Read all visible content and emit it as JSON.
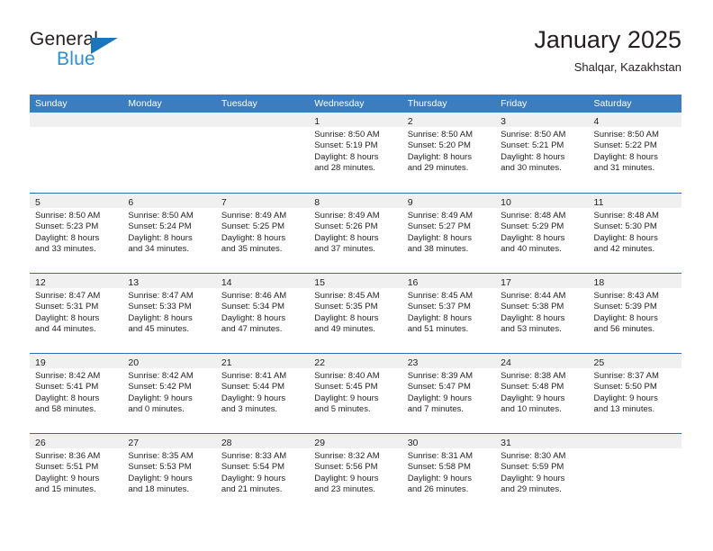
{
  "logo": {
    "word_top": "General",
    "word_bottom": "Blue",
    "triangle_color": "#1b75bb",
    "bottom_color": "#2b8fd4"
  },
  "header": {
    "title": "January 2025",
    "subtitle": "Shalqar, Kazakhstan"
  },
  "theme": {
    "header_band": "#3c7dbf",
    "row_divider": "#2f6fae",
    "day_band": "#f0f0f0",
    "text": "#231f20"
  },
  "weekdays": [
    "Sunday",
    "Monday",
    "Tuesday",
    "Wednesday",
    "Thursday",
    "Friday",
    "Saturday"
  ],
  "weeks": [
    [
      {
        "day": "",
        "sunrise": "",
        "sunset": "",
        "daylight_line1": "",
        "daylight_line2": ""
      },
      {
        "day": "",
        "sunrise": "",
        "sunset": "",
        "daylight_line1": "",
        "daylight_line2": ""
      },
      {
        "day": "",
        "sunrise": "",
        "sunset": "",
        "daylight_line1": "",
        "daylight_line2": ""
      },
      {
        "day": "1",
        "sunrise": "Sunrise: 8:50 AM",
        "sunset": "Sunset: 5:19 PM",
        "daylight_line1": "Daylight: 8 hours",
        "daylight_line2": "and 28 minutes."
      },
      {
        "day": "2",
        "sunrise": "Sunrise: 8:50 AM",
        "sunset": "Sunset: 5:20 PM",
        "daylight_line1": "Daylight: 8 hours",
        "daylight_line2": "and 29 minutes."
      },
      {
        "day": "3",
        "sunrise": "Sunrise: 8:50 AM",
        "sunset": "Sunset: 5:21 PM",
        "daylight_line1": "Daylight: 8 hours",
        "daylight_line2": "and 30 minutes."
      },
      {
        "day": "4",
        "sunrise": "Sunrise: 8:50 AM",
        "sunset": "Sunset: 5:22 PM",
        "daylight_line1": "Daylight: 8 hours",
        "daylight_line2": "and 31 minutes."
      }
    ],
    [
      {
        "day": "5",
        "sunrise": "Sunrise: 8:50 AM",
        "sunset": "Sunset: 5:23 PM",
        "daylight_line1": "Daylight: 8 hours",
        "daylight_line2": "and 33 minutes."
      },
      {
        "day": "6",
        "sunrise": "Sunrise: 8:50 AM",
        "sunset": "Sunset: 5:24 PM",
        "daylight_line1": "Daylight: 8 hours",
        "daylight_line2": "and 34 minutes."
      },
      {
        "day": "7",
        "sunrise": "Sunrise: 8:49 AM",
        "sunset": "Sunset: 5:25 PM",
        "daylight_line1": "Daylight: 8 hours",
        "daylight_line2": "and 35 minutes."
      },
      {
        "day": "8",
        "sunrise": "Sunrise: 8:49 AM",
        "sunset": "Sunset: 5:26 PM",
        "daylight_line1": "Daylight: 8 hours",
        "daylight_line2": "and 37 minutes."
      },
      {
        "day": "9",
        "sunrise": "Sunrise: 8:49 AM",
        "sunset": "Sunset: 5:27 PM",
        "daylight_line1": "Daylight: 8 hours",
        "daylight_line2": "and 38 minutes."
      },
      {
        "day": "10",
        "sunrise": "Sunrise: 8:48 AM",
        "sunset": "Sunset: 5:29 PM",
        "daylight_line1": "Daylight: 8 hours",
        "daylight_line2": "and 40 minutes."
      },
      {
        "day": "11",
        "sunrise": "Sunrise: 8:48 AM",
        "sunset": "Sunset: 5:30 PM",
        "daylight_line1": "Daylight: 8 hours",
        "daylight_line2": "and 42 minutes."
      }
    ],
    [
      {
        "day": "12",
        "sunrise": "Sunrise: 8:47 AM",
        "sunset": "Sunset: 5:31 PM",
        "daylight_line1": "Daylight: 8 hours",
        "daylight_line2": "and 44 minutes."
      },
      {
        "day": "13",
        "sunrise": "Sunrise: 8:47 AM",
        "sunset": "Sunset: 5:33 PM",
        "daylight_line1": "Daylight: 8 hours",
        "daylight_line2": "and 45 minutes."
      },
      {
        "day": "14",
        "sunrise": "Sunrise: 8:46 AM",
        "sunset": "Sunset: 5:34 PM",
        "daylight_line1": "Daylight: 8 hours",
        "daylight_line2": "and 47 minutes."
      },
      {
        "day": "15",
        "sunrise": "Sunrise: 8:45 AM",
        "sunset": "Sunset: 5:35 PM",
        "daylight_line1": "Daylight: 8 hours",
        "daylight_line2": "and 49 minutes."
      },
      {
        "day": "16",
        "sunrise": "Sunrise: 8:45 AM",
        "sunset": "Sunset: 5:37 PM",
        "daylight_line1": "Daylight: 8 hours",
        "daylight_line2": "and 51 minutes."
      },
      {
        "day": "17",
        "sunrise": "Sunrise: 8:44 AM",
        "sunset": "Sunset: 5:38 PM",
        "daylight_line1": "Daylight: 8 hours",
        "daylight_line2": "and 53 minutes."
      },
      {
        "day": "18",
        "sunrise": "Sunrise: 8:43 AM",
        "sunset": "Sunset: 5:39 PM",
        "daylight_line1": "Daylight: 8 hours",
        "daylight_line2": "and 56 minutes."
      }
    ],
    [
      {
        "day": "19",
        "sunrise": "Sunrise: 8:42 AM",
        "sunset": "Sunset: 5:41 PM",
        "daylight_line1": "Daylight: 8 hours",
        "daylight_line2": "and 58 minutes."
      },
      {
        "day": "20",
        "sunrise": "Sunrise: 8:42 AM",
        "sunset": "Sunset: 5:42 PM",
        "daylight_line1": "Daylight: 9 hours",
        "daylight_line2": "and 0 minutes."
      },
      {
        "day": "21",
        "sunrise": "Sunrise: 8:41 AM",
        "sunset": "Sunset: 5:44 PM",
        "daylight_line1": "Daylight: 9 hours",
        "daylight_line2": "and 3 minutes."
      },
      {
        "day": "22",
        "sunrise": "Sunrise: 8:40 AM",
        "sunset": "Sunset: 5:45 PM",
        "daylight_line1": "Daylight: 9 hours",
        "daylight_line2": "and 5 minutes."
      },
      {
        "day": "23",
        "sunrise": "Sunrise: 8:39 AM",
        "sunset": "Sunset: 5:47 PM",
        "daylight_line1": "Daylight: 9 hours",
        "daylight_line2": "and 7 minutes."
      },
      {
        "day": "24",
        "sunrise": "Sunrise: 8:38 AM",
        "sunset": "Sunset: 5:48 PM",
        "daylight_line1": "Daylight: 9 hours",
        "daylight_line2": "and 10 minutes."
      },
      {
        "day": "25",
        "sunrise": "Sunrise: 8:37 AM",
        "sunset": "Sunset: 5:50 PM",
        "daylight_line1": "Daylight: 9 hours",
        "daylight_line2": "and 13 minutes."
      }
    ],
    [
      {
        "day": "26",
        "sunrise": "Sunrise: 8:36 AM",
        "sunset": "Sunset: 5:51 PM",
        "daylight_line1": "Daylight: 9 hours",
        "daylight_line2": "and 15 minutes."
      },
      {
        "day": "27",
        "sunrise": "Sunrise: 8:35 AM",
        "sunset": "Sunset: 5:53 PM",
        "daylight_line1": "Daylight: 9 hours",
        "daylight_line2": "and 18 minutes."
      },
      {
        "day": "28",
        "sunrise": "Sunrise: 8:33 AM",
        "sunset": "Sunset: 5:54 PM",
        "daylight_line1": "Daylight: 9 hours",
        "daylight_line2": "and 21 minutes."
      },
      {
        "day": "29",
        "sunrise": "Sunrise: 8:32 AM",
        "sunset": "Sunset: 5:56 PM",
        "daylight_line1": "Daylight: 9 hours",
        "daylight_line2": "and 23 minutes."
      },
      {
        "day": "30",
        "sunrise": "Sunrise: 8:31 AM",
        "sunset": "Sunset: 5:58 PM",
        "daylight_line1": "Daylight: 9 hours",
        "daylight_line2": "and 26 minutes."
      },
      {
        "day": "31",
        "sunrise": "Sunrise: 8:30 AM",
        "sunset": "Sunset: 5:59 PM",
        "daylight_line1": "Daylight: 9 hours",
        "daylight_line2": "and 29 minutes."
      },
      {
        "day": "",
        "sunrise": "",
        "sunset": "",
        "daylight_line1": "",
        "daylight_line2": ""
      }
    ]
  ]
}
